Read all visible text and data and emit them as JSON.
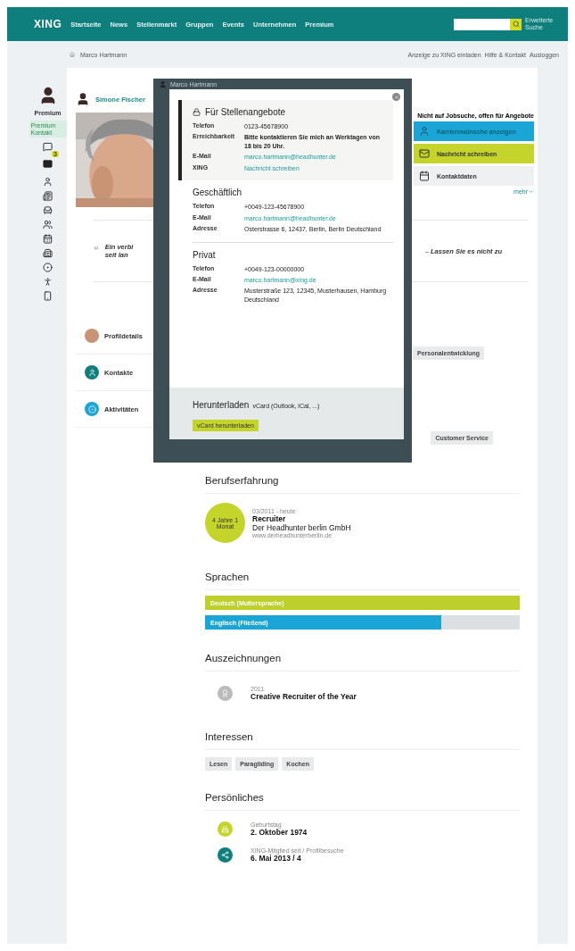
{
  "topbar": {
    "logo": "XING",
    "nav": [
      "Startseite",
      "News",
      "Stellenmarkt",
      "Gruppen",
      "Events",
      "Unternehmen",
      "Premium"
    ],
    "search_hint": "Erweiterte Suche"
  },
  "breadcrumb": "Marco Hartmann",
  "account_links": [
    "Anzeige zu XING einladen",
    "Hilfe & Kontakt",
    "Ausloggen"
  ],
  "sidebar": {
    "user_label": "Premium",
    "premium_badge": "Premium Kontakt",
    "message_count": "3"
  },
  "viewer": {
    "name": "Simone Fischer"
  },
  "profile": {
    "status": "Nicht auf Jobsuche, offen für Angebote",
    "actions": [
      {
        "kind": "career",
        "label": "Karrierewünsche anzeigen"
      },
      {
        "kind": "message",
        "label": "Nachricht schreiben"
      },
      {
        "kind": "contact",
        "label": "Kontaktdaten"
      }
    ],
    "more": "mehr",
    "quote_mark": "“",
    "quote_start": [
      "Ein verbi",
      "seit lan"
    ],
    "quote_end": "– Lassen Sie es nicht zu"
  },
  "profile_tabs": [
    {
      "label": "Profildetails"
    },
    {
      "kind": "contacts",
      "label": "Kontakte"
    },
    {
      "kind": "activity",
      "label": "Aktivitäten"
    }
  ],
  "partial_tags": [
    "Personalentwicklung",
    "Customer Service"
  ],
  "modal": {
    "name": "Marco Hartmann",
    "sections": [
      {
        "kind": "job",
        "title": "Für Stellenangebote",
        "rows": [
          {
            "label": "Telefon",
            "value": "0123-45678900",
            "kind": "text"
          },
          {
            "label": "Erreichbarkeit",
            "value": "Bitte kontaktieren Sie mich an Werktagen von 18 bis 20 Uhr.",
            "kind": "strong"
          },
          {
            "label": "E-Mail",
            "value": "marco.hartmann@headhunter.de",
            "kind": "link"
          },
          {
            "label": "XING",
            "value": "Nachricht schreiben",
            "kind": "link"
          }
        ]
      },
      {
        "kind": "plain",
        "title": "Geschäftlich",
        "rows": [
          {
            "label": "Telefon",
            "value": "+0049-123-45678900",
            "kind": "text"
          },
          {
            "label": "E-Mail",
            "value": "marco.hartmann@headhunter.de",
            "kind": "link"
          },
          {
            "label": "Adresse",
            "value": "Osterstrasse 6, 12437, Berlin, Berlin Deutschland",
            "kind": "text"
          }
        ]
      },
      {
        "kind": "plain",
        "title": "Privat",
        "rows": [
          {
            "label": "Telefon",
            "value": "+0049-123-00000000",
            "kind": "text"
          },
          {
            "label": "E-Mail",
            "value": "marco.hartmann@xing.de",
            "kind": "link"
          },
          {
            "label": "Adresse",
            "value": "Musterstraße 123, 12345, Musterhausen, Hamburg Deutschland",
            "kind": "text"
          }
        ]
      }
    ],
    "download": {
      "title": "Herunterladen",
      "subtitle": "vCard (Outlook, iCal, ...)",
      "button": "vCard herunterladen"
    }
  },
  "experience": {
    "title": "Berufserfahrung",
    "items": [
      {
        "duration": "4 Jahre 1 Monat",
        "period": "03/2011 - heute",
        "position": "Recruiter",
        "company": "Der Headhunter berlin GmbH",
        "url": "www.derheadhunterberlin.de"
      }
    ]
  },
  "languages": {
    "title": "Sprachen",
    "items": [
      {
        "label": "Deutsch (Muttersprache)",
        "level": 1,
        "color": "#bccf2a"
      },
      {
        "label": "Englisch (Fließend)",
        "level": 0.75,
        "color": "#1aa5d6"
      }
    ]
  },
  "awards": {
    "title": "Auszeichnungen",
    "items": [
      {
        "year": "2011",
        "name": "Creative Recruiter of the Year"
      }
    ]
  },
  "interests": {
    "title": "Interessen",
    "tags": [
      "Lesen",
      "Paragliding",
      "Kochen"
    ]
  },
  "personal": {
    "title": "Persönliches",
    "items": [
      {
        "kind": "birthday",
        "label": "Geburtstag",
        "value": "2. Oktober 1974"
      },
      {
        "kind": "member",
        "label": "XING-Mitglied seit / Profilbesuche",
        "value": "6. Mai 2013 / 4"
      }
    ]
  }
}
